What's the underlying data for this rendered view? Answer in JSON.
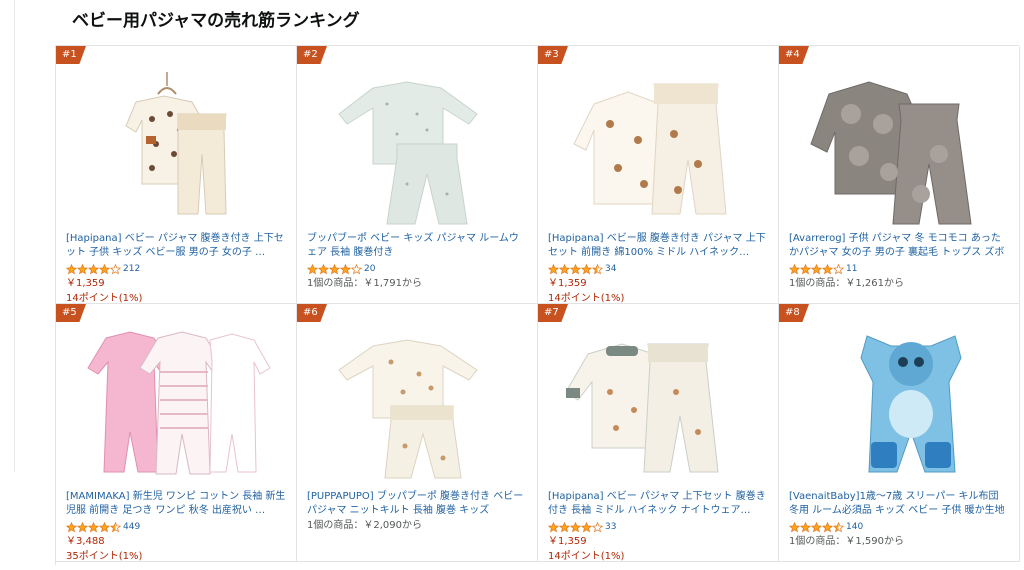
{
  "page": {
    "title": "ベビー用パジャマの売れ筋ランキング"
  },
  "colors": {
    "accent": "#C7511F",
    "link": "#2162A1",
    "price": "#B12704",
    "star": "#FFA41C"
  },
  "products": [
    {
      "rank": "#1",
      "title": "[Hapipana] ベビー パジャマ 腹巻き付き 上下セット 子供 キッズ ベビー服 男の子 女の子 …",
      "rating": 4.0,
      "reviews": "212",
      "price": "￥1,359",
      "points": "14ポイント(1%)",
      "offers": ""
    },
    {
      "rank": "#2",
      "title": "ブッパブーポ ベビー キッズ パジャマ ルームウェア 長袖 腹巻付き",
      "rating": 4.0,
      "reviews": "20",
      "price": "",
      "points": "",
      "offers": "1個の商品：￥1,791から"
    },
    {
      "rank": "#3",
      "title": "[Hapipana] ベビー服 腹巻き付き パジャマ 上下セット 前開き 綿100% ミドル ハイネック…",
      "rating": 4.5,
      "reviews": "34",
      "price": "￥1,359",
      "points": "14ポイント(1%)",
      "offers": ""
    },
    {
      "rank": "#4",
      "title": "[Avarrerog] 子供 パジャマ 冬 モコモコ あったかパジャマ 女の子 男の子 裏起毛 トップス ズボン 上下セット 無地 丸首 熊の柄 かわいい …",
      "rating": 4.0,
      "reviews": "11",
      "price": "",
      "points": "",
      "offers": "1個の商品：￥1,261から"
    },
    {
      "rank": "#5",
      "title": "[MAMIMAKA] 新生児 ワンピ コットン 長袖 新生児服 前開き 足つき ワンピ 秋冬 出産祝い …",
      "rating": 4.5,
      "reviews": "449",
      "price": "￥3,488",
      "points": "35ポイント(1%)",
      "offers": ""
    },
    {
      "rank": "#6",
      "title": "[PUPPAPUPO] ブッパブーポ 腹巻き付き ベビー パジャマ ニットキルト 長袖 腹巻 キッズ",
      "rating": 0,
      "reviews": "",
      "price": "",
      "points": "",
      "offers": "1個の商品：￥2,090から"
    },
    {
      "rank": "#7",
      "title": "[Hapipana] ベビー パジャマ 上下セット 腹巻き付き 長袖 ミドル ハイネック ナイトウェア…",
      "rating": 4.0,
      "reviews": "33",
      "price": "￥1,359",
      "points": "14ポイント(1%)",
      "offers": ""
    },
    {
      "rank": "#8",
      "title": "[VaenaitBaby]1歳〜7歳 スリーパー キル布団 冬用 ルーム必須品 キッズ ベビー 子供 暖か生地 寝袋 保温ブランケット マイクロファイバ…",
      "rating": 4.5,
      "reviews": "140",
      "price": "",
      "points": "",
      "offers": "1個の商品：￥1,590から"
    }
  ]
}
